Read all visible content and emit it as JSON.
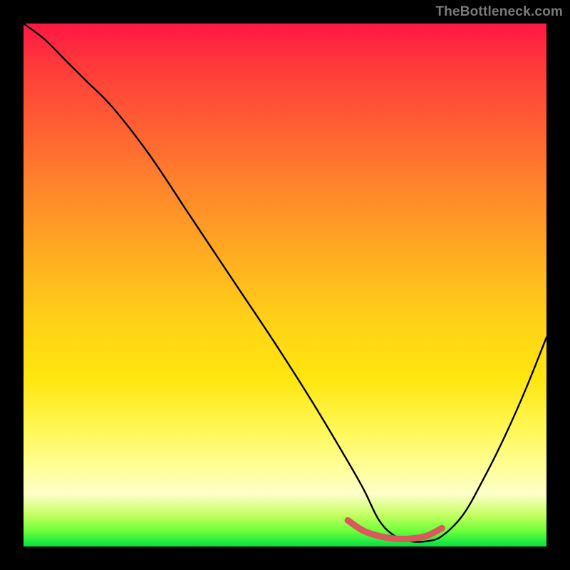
{
  "watermark": "TheBottleneck.com",
  "chart_data": {
    "type": "line",
    "title": "",
    "xlabel": "",
    "ylabel": "",
    "xlim": [
      0,
      100
    ],
    "ylim": [
      0,
      100
    ],
    "series": [
      {
        "name": "bottleneck-curve",
        "color": "#000000",
        "x": [
          0,
          4,
          8,
          12,
          17,
          24,
          32,
          40,
          48,
          55,
          61,
          65,
          68,
          71,
          74,
          77,
          80,
          84,
          88,
          92,
          96,
          100
        ],
        "values": [
          100,
          97,
          93,
          89,
          84,
          75,
          63,
          51,
          39,
          28,
          18,
          11,
          5,
          2,
          1,
          1,
          2,
          6,
          13,
          21,
          30,
          40
        ]
      },
      {
        "name": "optimal-region",
        "color": "#d85a5a",
        "x": [
          62,
          65,
          68,
          71,
          74,
          77,
          80
        ],
        "values": [
          5,
          3,
          2,
          1.5,
          1.5,
          2,
          3.5
        ]
      }
    ]
  },
  "colors": {
    "background": "#000000",
    "curve": "#000000",
    "highlight": "#d85a5a",
    "watermark": "#7a7a7a"
  }
}
